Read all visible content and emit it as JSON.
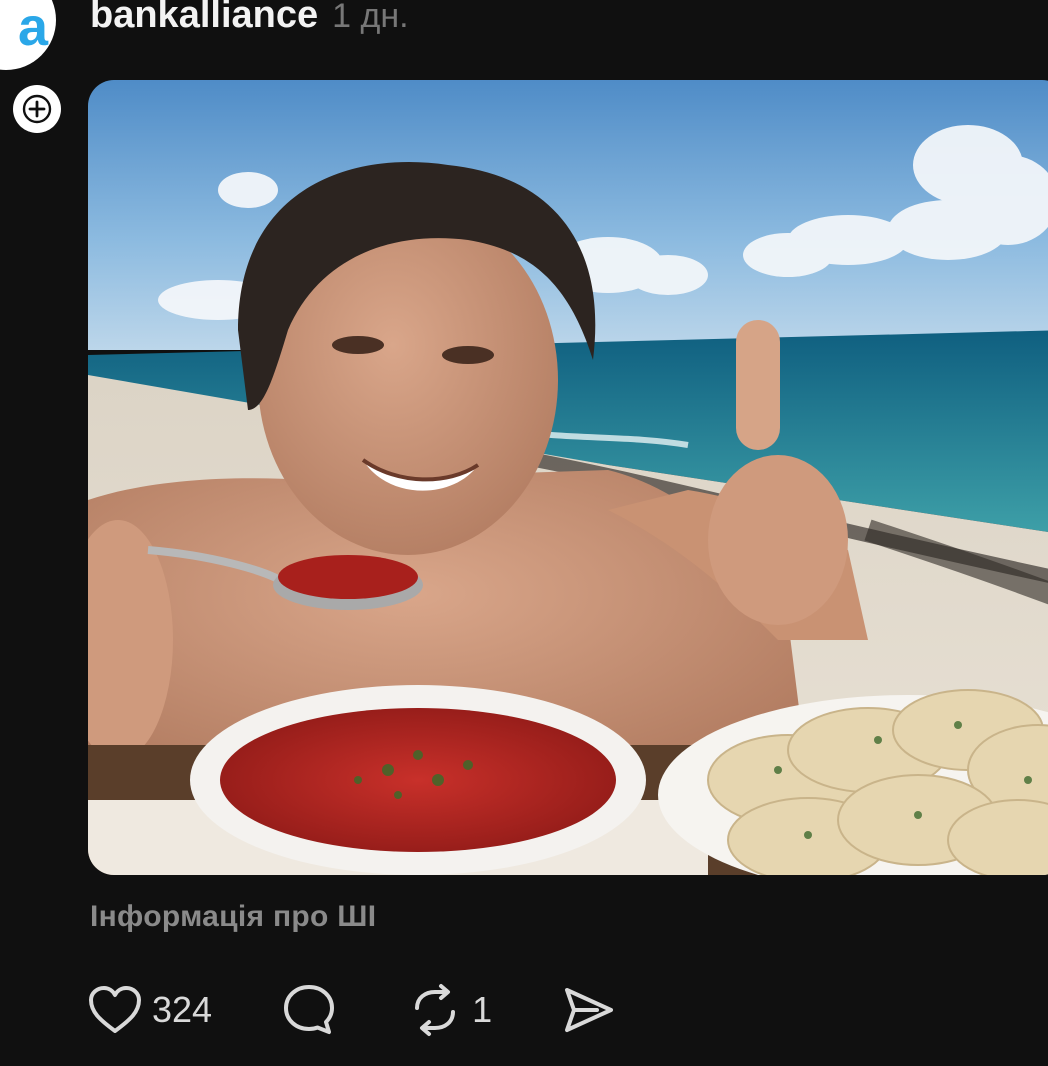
{
  "post": {
    "username": "bankalliance",
    "timestamp": "1 дн.",
    "avatar_glyph": "a",
    "image_alt": "Photo: man on a beach eating red borscht with a spoon, thumbs up, with a plate of dumplings",
    "ai_info_label": "Інформація про ШІ",
    "actions": {
      "like_icon": "heart-icon",
      "like_count": "324",
      "comment_icon": "comment-bubble-icon",
      "repost_icon": "repost-icon",
      "repost_count": "1",
      "share_icon": "send-icon"
    },
    "colors": {
      "background": "#101010",
      "username": "#f3f3f3",
      "muted_text": "#8a8a8a",
      "icon": "#d9d9d9",
      "avatar_accent": "#2aa7e8"
    }
  }
}
